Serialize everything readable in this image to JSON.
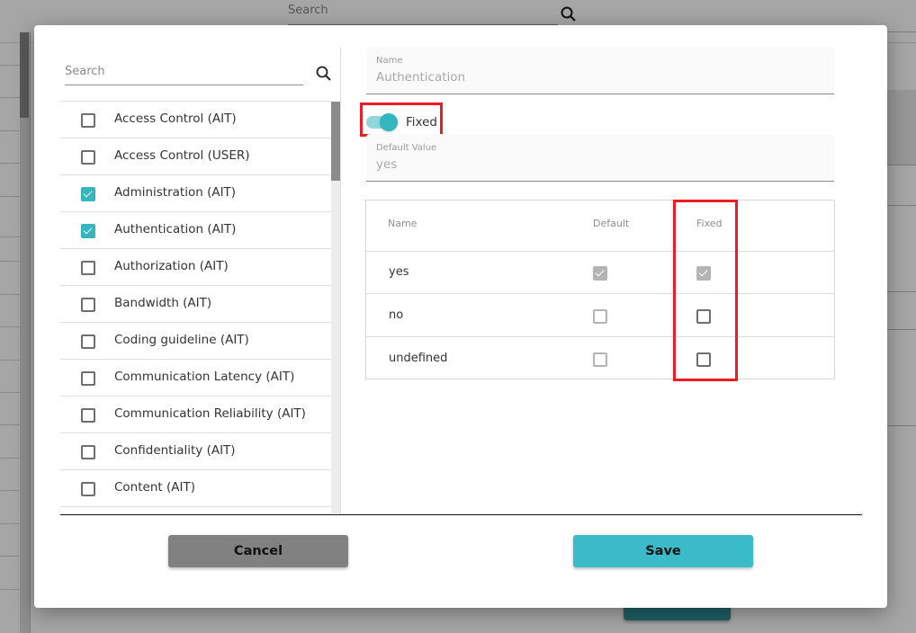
{
  "background": {
    "search_placeholder": "Search",
    "search_icon": "search-icon"
  },
  "dialog": {
    "left": {
      "search_placeholder": "Search",
      "search_value": "",
      "search_icon": "search-icon",
      "items": [
        {
          "label": "Access Control (AIT)",
          "checked": false
        },
        {
          "label": "Access Control (USER)",
          "checked": false
        },
        {
          "label": "Administration (AIT)",
          "checked": true
        },
        {
          "label": "Authentication (AIT)",
          "checked": true
        },
        {
          "label": "Authorization (AIT)",
          "checked": false
        },
        {
          "label": "Bandwidth (AIT)",
          "checked": false
        },
        {
          "label": "Coding guideline (AIT)",
          "checked": false
        },
        {
          "label": "Communication Latency (AIT)",
          "checked": false
        },
        {
          "label": "Communication Reliability (AIT)",
          "checked": false
        },
        {
          "label": "Confidentiality (AIT)",
          "checked": false
        },
        {
          "label": "Content (AIT)",
          "checked": false
        }
      ]
    },
    "right": {
      "name_field": {
        "label": "Name",
        "value": "Authentication"
      },
      "fixed_toggle": {
        "label": "Fixed",
        "on": true
      },
      "default_field": {
        "label": "Default Value",
        "value": "yes"
      },
      "table": {
        "columns": [
          "Name",
          "Default",
          "Fixed"
        ],
        "rows": [
          {
            "name": "yes",
            "default": true,
            "fixed": true
          },
          {
            "name": "no",
            "default": false,
            "fixed": false
          },
          {
            "name": "undefined",
            "default": false,
            "fixed": false
          }
        ]
      }
    },
    "buttons": {
      "cancel": "Cancel",
      "save": "Save"
    },
    "colors": {
      "accent": "#35b6bf",
      "save_button": "#3bbac8",
      "cancel_button": "#818181",
      "highlight": "#ec1c24"
    }
  }
}
